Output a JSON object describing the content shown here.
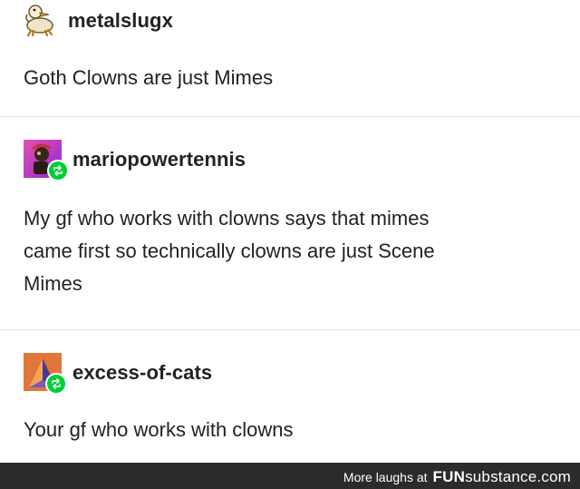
{
  "posts": [
    {
      "username": "metalslugx",
      "text": "Goth Clowns are just Mimes",
      "avatar": "duck-avatar-icon",
      "reblog": false
    },
    {
      "username": "mariopowertennis",
      "text_lines": [
        "My gf who works with clowns says that mimes",
        "came first so technically clowns are just Scene",
        "Mimes"
      ],
      "avatar": "mario-avatar-icon",
      "reblog": true
    },
    {
      "username": "excess-of-cats",
      "text": "Your gf who works with clowns",
      "avatar": "cat-avatar-icon",
      "reblog": true
    }
  ],
  "footer": {
    "prefix": "More laughs at",
    "brand_bold": "FUN",
    "brand_rest": "substance.com"
  },
  "colors": {
    "reblog_green": "#00cf35",
    "footer_bg": "#2b2b2b",
    "divider": "#e2e2e2"
  }
}
